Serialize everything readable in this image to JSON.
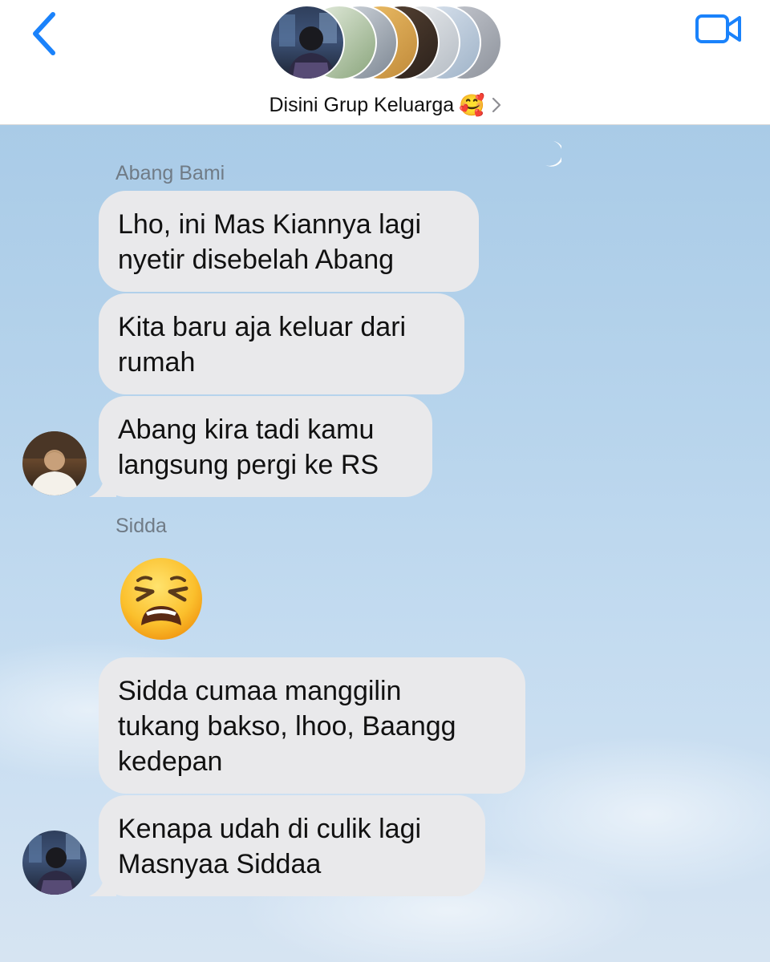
{
  "header": {
    "group_name": "Disini Grup Keluarga",
    "group_emoji": "🥰",
    "icons": {
      "back": "chevron-left-icon",
      "video": "video-camera-icon",
      "info": "chevron-right-icon"
    },
    "accent_color": "#1a82fb",
    "member_avatar_count": 7
  },
  "messages": [
    {
      "sender": "Abang Bami",
      "bubbles": [
        [
          "Lho, ini Mas Kiannya lagi",
          "nyetir disebelah Abang"
        ],
        [
          "Kita baru aja keluar dari",
          "rumah"
        ],
        [
          "Abang kira tadi kamu",
          "langsung pergi ke RS"
        ]
      ]
    },
    {
      "sender": "Sidda",
      "emoji": "tired-face-emoji",
      "bubbles": [
        [
          "Sidda cumaa manggilin",
          "tukang bakso, lhoo, Baangg",
          "kedepan"
        ],
        [
          "Kenapa udah di culik lagi",
          "Masnyaa Siddaa"
        ]
      ]
    }
  ],
  "colors": {
    "bubble": "#e9e9eb",
    "sender_label": "#707b86",
    "chat_background": "#b7d4ec"
  }
}
